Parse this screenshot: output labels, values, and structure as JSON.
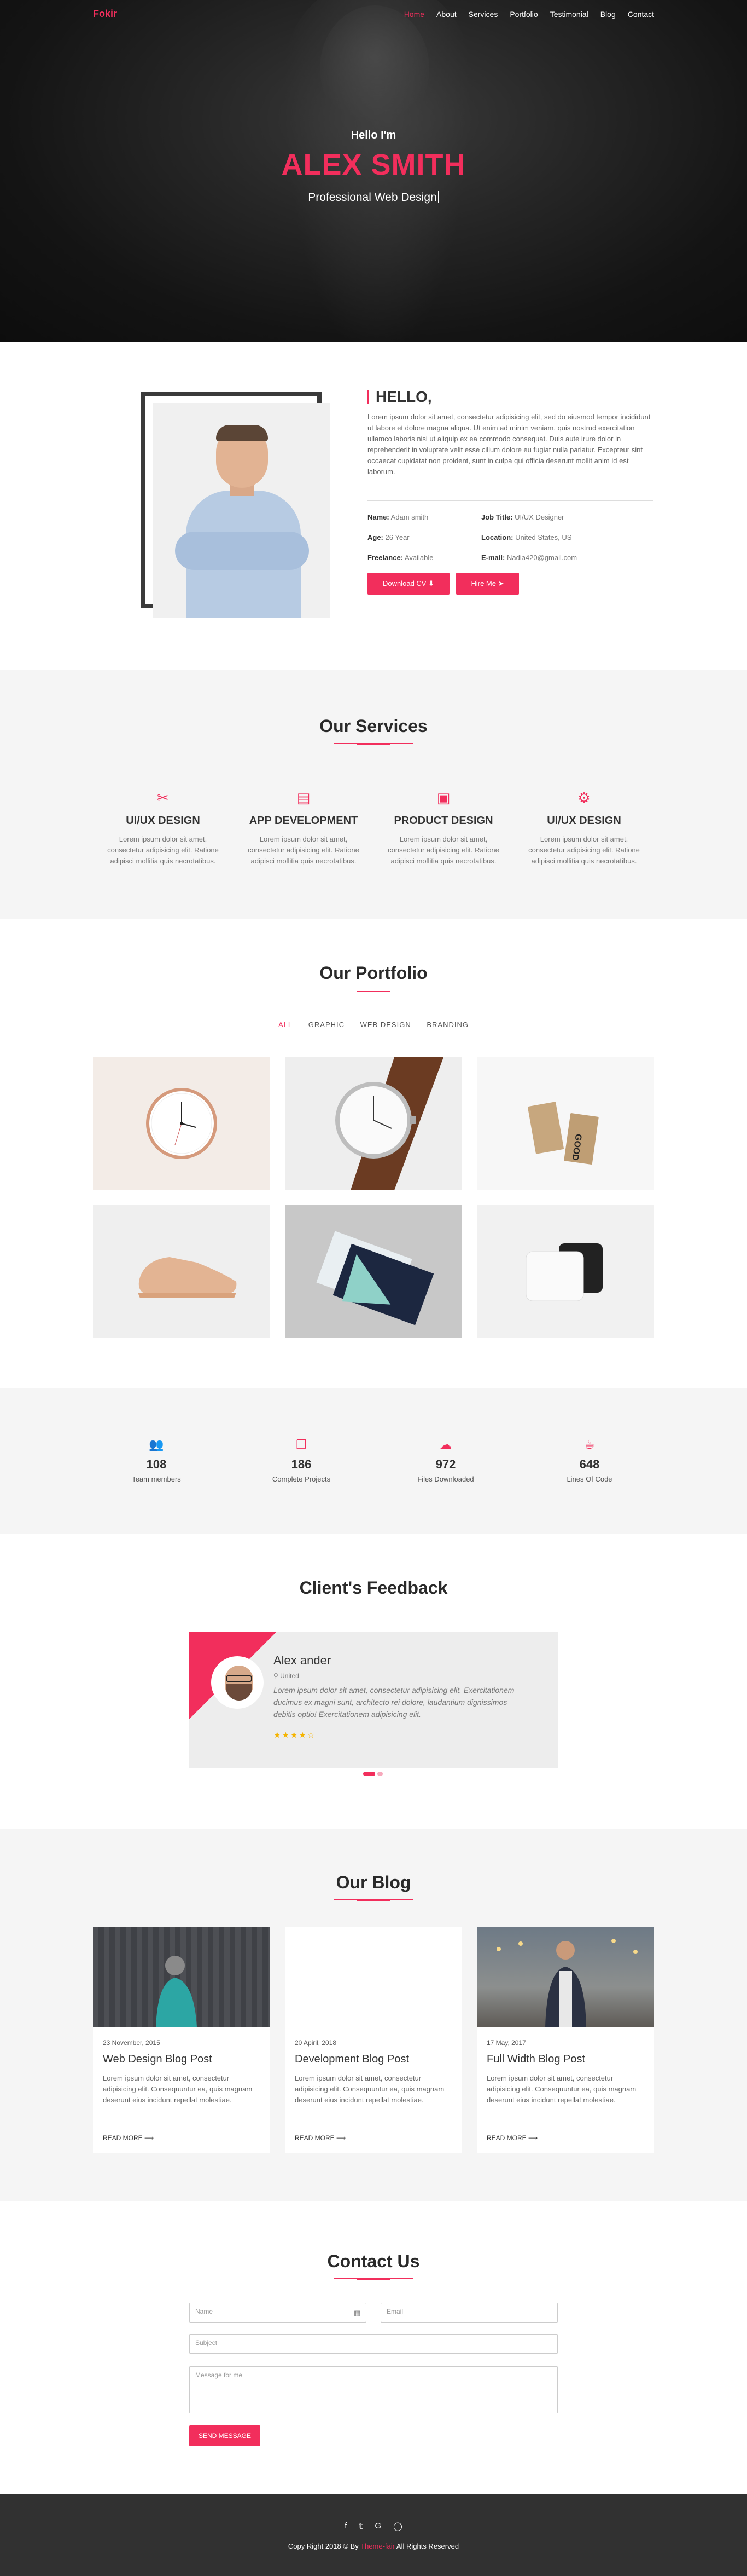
{
  "nav": {
    "logo": "Fokir",
    "items": [
      "Home",
      "About",
      "Services",
      "Portfolio",
      "Testimonial",
      "Blog",
      "Contact"
    ],
    "active": "Home"
  },
  "hero": {
    "greeting": "Hello I'm",
    "name": "ALEX SMITH",
    "role": "Professional Web Design"
  },
  "about": {
    "heading": "HELLO,",
    "paragraph": "Lorem ipsum dolor sit amet, consectetur adipisicing elit, sed do eiusmod tempor incididunt ut labore et dolore magna aliqua. Ut enim ad minim veniam, quis nostrud exercitation ullamco laboris nisi ut aliquip ex ea commodo consequat. Duis aute irure dolor in reprehenderit in voluptate velit esse cillum dolore eu fugiat nulla pariatur. Excepteur sint occaecat cupidatat non proident, sunt in culpa qui officia deserunt mollit anim id est laborum.",
    "info": [
      {
        "label": "Name:",
        "value": "Adam smith"
      },
      {
        "label": "Job Title:",
        "value": "UI/UX Designer"
      },
      {
        "label": "Age:",
        "value": "26 Year"
      },
      {
        "label": "Location:",
        "value": "United States, US"
      },
      {
        "label": "Freelance:",
        "value": "Available"
      },
      {
        "label": "E-mail:",
        "value": "Nadia420@gmail.com"
      }
    ],
    "download_label": "Download CV",
    "hire_label": "Hire Me"
  },
  "services": {
    "title": "Our Services",
    "items": [
      {
        "icon": "tools-icon",
        "name": "UI/UX DESIGN",
        "desc": "Lorem ipsum dolor sit amet, consectetur adipisicing elit. Ratione adipisci mollitia quis necrotatibus."
      },
      {
        "icon": "browser-icon",
        "name": "APP DEVELOPMENT",
        "desc": "Lorem ipsum dolor sit amet, consectetur adipisicing elit. Ratione adipisci mollitia quis necrotatibus."
      },
      {
        "icon": "browser-code-icon",
        "name": "PRODUCT DESIGN",
        "desc": "Lorem ipsum dolor sit amet, consectetur adipisicing elit. Ratione adipisci mollitia quis necrotatibus."
      },
      {
        "icon": "gears-icon",
        "name": "UI/UX DESIGN",
        "desc": "Lorem ipsum dolor sit amet, consectetur adipisicing elit. Ratione adipisci mollitia quis necrotatibus."
      }
    ]
  },
  "portfolio": {
    "title": "Our Portfolio",
    "filters": [
      "ALL",
      "GRAPHIC",
      "WEB DESIGN",
      "BRANDING"
    ],
    "active_filter": "ALL",
    "items": [
      "wall-clock-image",
      "wristwatch-image",
      "business-cards-image",
      "sneaker-image",
      "card-mockup-image",
      "power-bank-image"
    ]
  },
  "counters": [
    {
      "icon": "users-icon",
      "number": "108",
      "label": "Team members"
    },
    {
      "icon": "cubes-icon",
      "number": "186",
      "label": "Complete Projects"
    },
    {
      "icon": "cloud-download-icon",
      "number": "972",
      "label": "Files Downloaded"
    },
    {
      "icon": "coffee-icon",
      "number": "648",
      "label": "Lines Of Code"
    }
  ],
  "feedback": {
    "title": "Client's Feedback",
    "name": "Alex ander",
    "location": "United",
    "text": "Lorem ipsum dolor sit amet, consectetur adipisicing elit. Exercitationem ducimus ex magni sunt, architecto rei dolore, laudantium dignissimos debitis optio! Exercitationem adipisicing elit.",
    "rating": 4,
    "rating_max": 5,
    "stars": "★★★★☆"
  },
  "blog": {
    "title": "Our Blog",
    "posts": [
      {
        "date": "23 November, 2015",
        "title": "Web Design Blog Post",
        "excerpt": "Lorem ipsum dolor sit amet, consectetur adipisicing elit. Consequuntur ea, quis magnam deserunt eius incidunt repellat molestiae.",
        "more": "READ MORE ⟶"
      },
      {
        "date": "20 Apiril, 2018",
        "title": "Development Blog Post",
        "excerpt": "Lorem ipsum dolor sit amet, consectetur adipisicing elit. Consequuntur ea, quis magnam deserunt eius incidunt repellat molestiae.",
        "more": "READ MORE ⟶"
      },
      {
        "date": "17 May, 2017",
        "title": "Full Width Blog Post",
        "excerpt": "Lorem ipsum dolor sit amet, consectetur adipisicing elit. Consequuntur ea, quis magnam deserunt eius incidunt repellat molestiae.",
        "more": "READ MORE ⟶"
      }
    ]
  },
  "contact": {
    "title": "Contact Us",
    "name_placeholder": "Name",
    "email_placeholder": "Email",
    "subject_placeholder": "Subject",
    "message_placeholder": "Message for me",
    "send_label": "SEND MESSAGE"
  },
  "footer": {
    "socials": [
      "f",
      "𝕥",
      "G",
      "◯"
    ],
    "copy_prefix": "Copy Right 2018 © By",
    "copy_brand": "Theme-fair",
    "copy_suffix": "All Rights Reserved"
  },
  "colors": {
    "accent": "#f22e5c",
    "dark": "#313131",
    "light": "#f5f5f5"
  }
}
